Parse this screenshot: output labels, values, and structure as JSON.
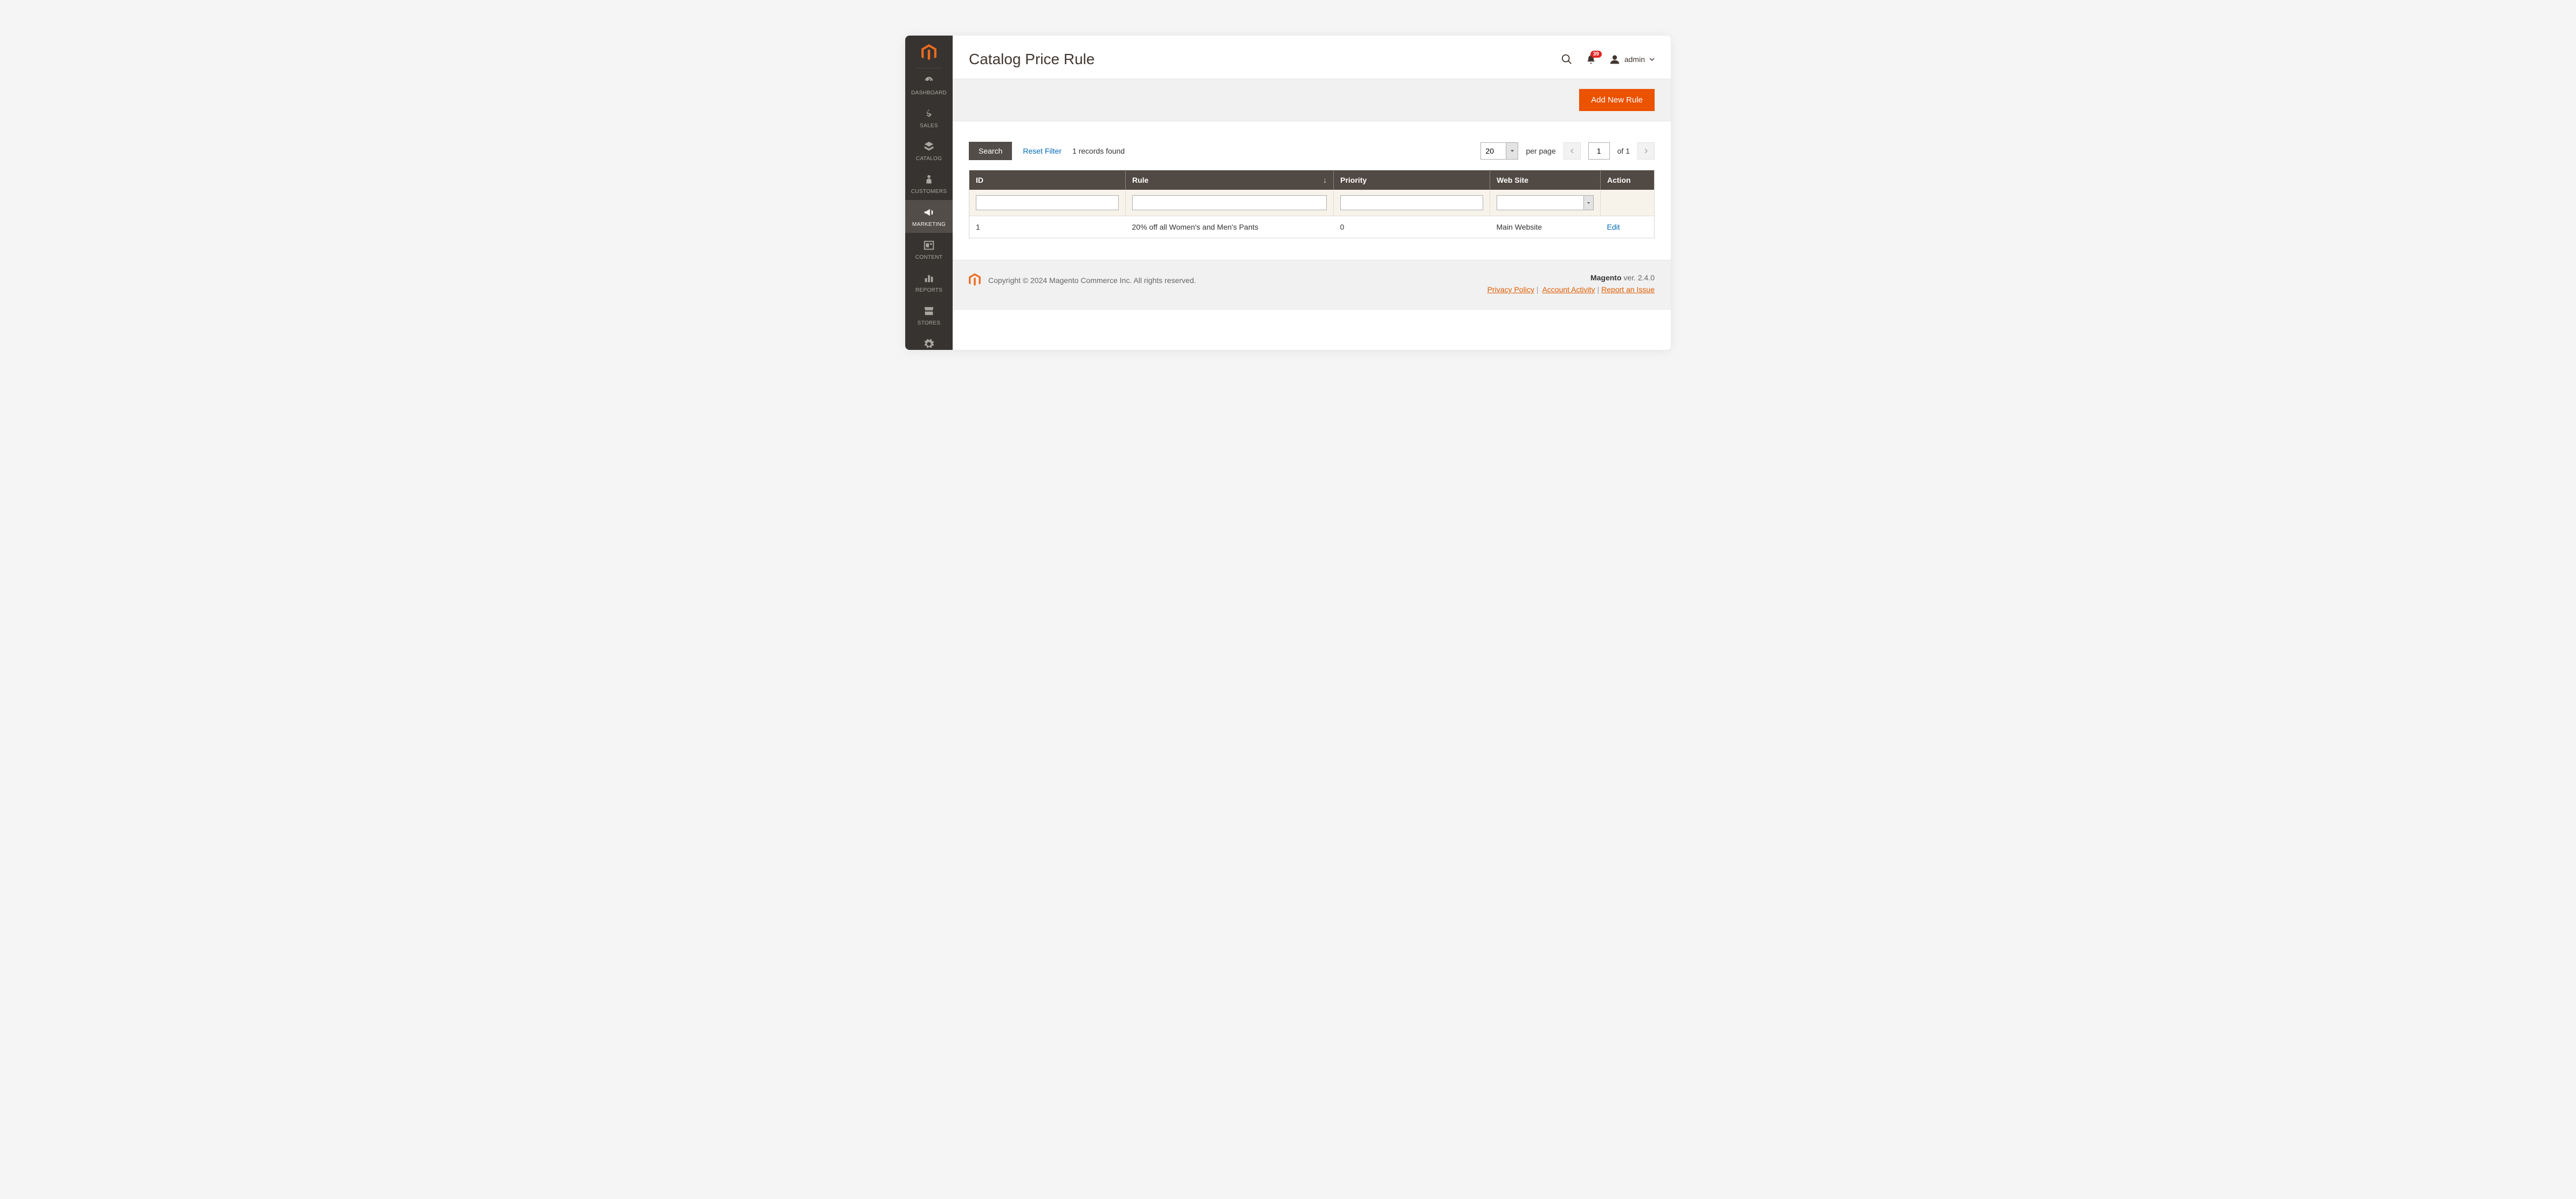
{
  "sidebar": {
    "items": [
      {
        "label": "DASHBOARD"
      },
      {
        "label": "SALES"
      },
      {
        "label": "CATALOG"
      },
      {
        "label": "CUSTOMERS"
      },
      {
        "label": "MARKETING"
      },
      {
        "label": "CONTENT"
      },
      {
        "label": "REPORTS"
      },
      {
        "label": "STORES"
      }
    ]
  },
  "header": {
    "title": "Catalog Price Rule",
    "notif_count": "39",
    "username": "admin"
  },
  "toolbar": {
    "add_label": "Add New Rule"
  },
  "controls": {
    "search_label": "Search",
    "reset_label": "Reset Filter",
    "records_text": "1 records found",
    "page_size": "20",
    "per_page_label": "per page",
    "current_page": "1",
    "of_label": "of 1"
  },
  "grid": {
    "columns": {
      "id": "ID",
      "rule": "Rule",
      "priority": "Priority",
      "website": "Web Site",
      "action": "Action"
    },
    "rows": [
      {
        "id": "1",
        "rule": "20% off all Women's and Men's Pants",
        "priority": "0",
        "website": "Main Website",
        "action": "Edit"
      }
    ]
  },
  "footer": {
    "copyright": "Copyright © 2024 Magento Commerce Inc. All rights reserved.",
    "product": "Magento",
    "version": " ver. 2.4.0",
    "links": {
      "privacy": "Privacy Policy",
      "activity": "Account Activity",
      "report": "Report an Issue"
    }
  }
}
